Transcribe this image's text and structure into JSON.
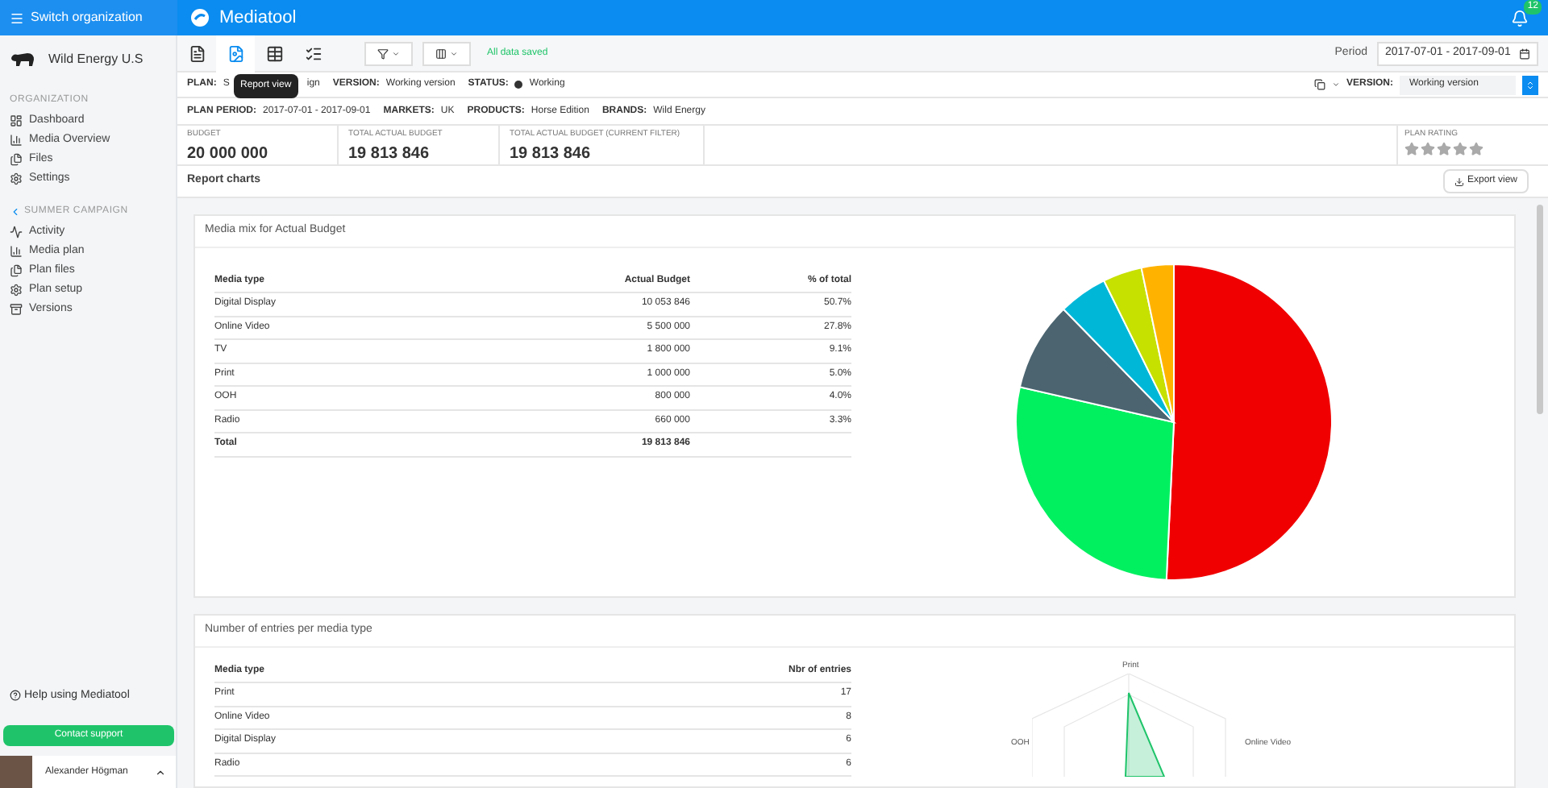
{
  "topbar": {
    "switch_org": "Switch organization",
    "app_name": "Mediatool",
    "notification_count": "12"
  },
  "sidebar": {
    "org_name": "Wild Energy U.S",
    "sections": [
      {
        "heading": "ORGANIZATION",
        "back": false,
        "items": [
          "Dashboard",
          "Media Overview",
          "Files",
          "Settings"
        ]
      },
      {
        "heading": "SUMMER CAMPAIGN",
        "back": true,
        "items": [
          "Activity",
          "Media plan",
          "Plan files",
          "Plan setup",
          "Versions"
        ]
      }
    ],
    "help": "Help using Mediatool",
    "support_button": "Contact support",
    "user_name": "Alexander Högman"
  },
  "toolbar": {
    "views": [
      {
        "selected": false
      },
      {
        "selected": true
      },
      {
        "selected": false
      },
      {
        "selected": false
      }
    ],
    "tooltip": "Report view",
    "save_status": "All data saved",
    "period_label": "Period",
    "period_value": "2017-07-01 - 2017-09-01"
  },
  "plan_info": {
    "plan_label": "PLAN:",
    "plan_value_before": "S",
    "plan_value_after": "ign",
    "version_label": "VERSION:",
    "version_value": "Working version",
    "status_label": "STATUS:",
    "status_value": "Working",
    "version_select_label": "VERSION:",
    "version_select_value": "Working version"
  },
  "plan_meta": [
    {
      "label": "PLAN PERIOD:",
      "value": "2017-07-01 - 2017-09-01"
    },
    {
      "label": "MARKETS:",
      "value": "UK"
    },
    {
      "label": "PRODUCTS:",
      "value": "Horse Edition"
    },
    {
      "label": "BRANDS:",
      "value": "Wild Energy"
    }
  ],
  "budgets": [
    {
      "label": "BUDGET",
      "value": "20 000 000"
    },
    {
      "label": "TOTAL ACTUAL BUDGET",
      "value": "19 813 846"
    },
    {
      "label": "TOTAL ACTUAL BUDGET (CURRENT FILTER)",
      "value": "19 813 846"
    }
  ],
  "plan_rating": {
    "label": "PLAN RATING",
    "stars": 0
  },
  "report": {
    "title": "Report charts",
    "export_button": "Export view"
  },
  "media_mix": {
    "title": "Media mix for Actual Budget",
    "columns": [
      "Media type",
      "Actual Budget",
      "% of total"
    ],
    "rows": [
      [
        "Digital Display",
        "10 053 846",
        "50.7%"
      ],
      [
        "Online Video",
        "5 500 000",
        "27.8%"
      ],
      [
        "TV",
        "1 800 000",
        "9.1%"
      ],
      [
        "Print",
        "1 000 000",
        "5.0%"
      ],
      [
        "OOH",
        "800 000",
        "4.0%"
      ],
      [
        "Radio",
        "660 000",
        "3.3%"
      ]
    ],
    "total": [
      "Total",
      "19 813 846"
    ]
  },
  "entries": {
    "title": "Number of entries per media type",
    "columns": [
      "Media type",
      "Nbr of entries"
    ],
    "rows": [
      [
        "Print",
        "17"
      ],
      [
        "Online Video",
        "8"
      ],
      [
        "Digital Display",
        "6"
      ],
      [
        "Radio",
        "6"
      ]
    ],
    "radar_labels": [
      "Print",
      "Online Video",
      "OOH"
    ]
  }
}
